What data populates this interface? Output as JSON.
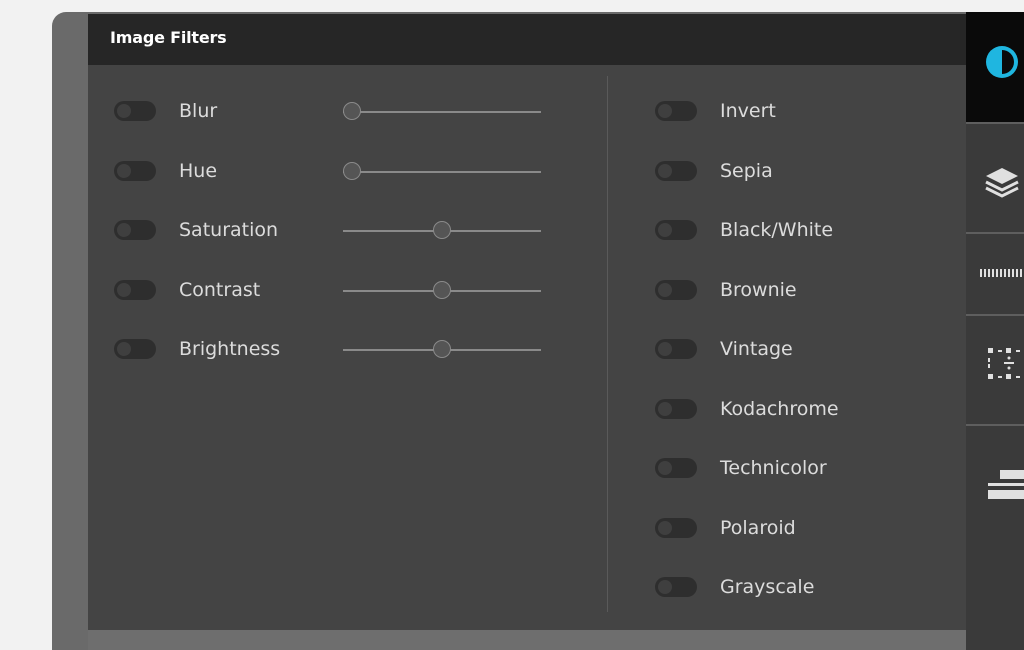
{
  "panel": {
    "title": "Image Filters"
  },
  "adjustable_filters": [
    {
      "label": "Blur",
      "enabled": false,
      "value": 0
    },
    {
      "label": "Hue",
      "enabled": false,
      "value": 0
    },
    {
      "label": "Saturation",
      "enabled": false,
      "value": 0.5
    },
    {
      "label": "Contrast",
      "enabled": false,
      "value": 0.5
    },
    {
      "label": "Brightness",
      "enabled": false,
      "value": 0.5
    }
  ],
  "preset_filters": [
    {
      "label": "Invert",
      "enabled": false
    },
    {
      "label": "Sepia",
      "enabled": false
    },
    {
      "label": "Black/White",
      "enabled": false
    },
    {
      "label": "Brownie",
      "enabled": false
    },
    {
      "label": "Vintage",
      "enabled": false
    },
    {
      "label": "Kodachrome",
      "enabled": false
    },
    {
      "label": "Technicolor",
      "enabled": false
    },
    {
      "label": "Polaroid",
      "enabled": false
    },
    {
      "label": "Grayscale",
      "enabled": false
    }
  ],
  "toolbar": {
    "tools": [
      {
        "icon": "contrast-icon",
        "active": true,
        "accent": "#1fb6e0"
      },
      {
        "icon": "layers-icon",
        "active": false
      },
      {
        "icon": "ruler-icon",
        "active": false
      },
      {
        "icon": "grid-divide-icon",
        "active": false
      },
      {
        "icon": "align-icon",
        "active": false
      }
    ]
  },
  "colors": {
    "panel_bg": "#444444",
    "header_bg": "#262626",
    "text": "#dcdcdc",
    "accent": "#1fb6e0"
  }
}
